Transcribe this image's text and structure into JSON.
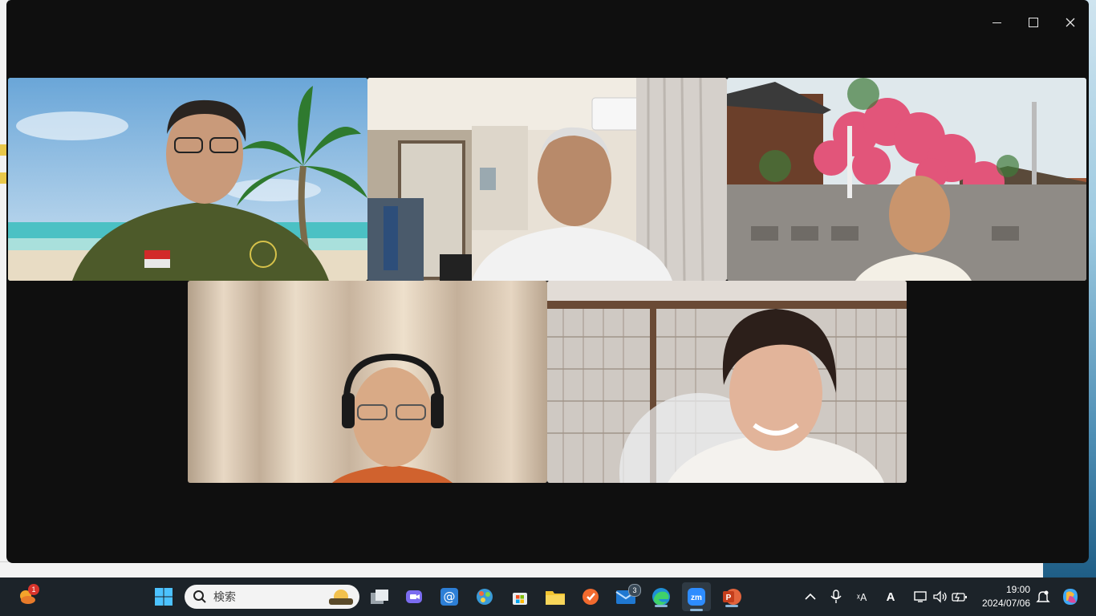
{
  "window": {
    "controls": {
      "minimize": "minimize-icon",
      "maximize": "maximize-icon",
      "close": "close-icon"
    }
  },
  "gallery": {
    "active_speaker_color": "#27d57a",
    "participants": [
      {
        "id": "p1",
        "scene": "virtual beach background with palm tree",
        "active": true
      },
      {
        "id": "p2",
        "scene": "room with air conditioner and curtains",
        "active": false
      },
      {
        "id": "p3",
        "scene": "outdoor with pink roses and concrete wall",
        "active": false
      },
      {
        "id": "p4",
        "scene": "beige curtain background, headphones",
        "active": false
      },
      {
        "id": "p5",
        "scene": "shoji screen background",
        "active": false
      }
    ]
  },
  "taskbar": {
    "weather_badge": "1",
    "search_placeholder": "検索",
    "mail_badge": "3",
    "apps": [
      "windows-start-icon",
      "task-view-icon",
      "teams-meet-icon",
      "mail-at-icon",
      "paint-icon",
      "store-icon",
      "file-explorer-icon",
      "orange-app-icon",
      "mail-icon",
      "edge-icon",
      "zoom-icon",
      "powerpoint-icon"
    ],
    "tray": {
      "ime": "A",
      "time": "19:00",
      "date": "2024/07/06"
    }
  }
}
